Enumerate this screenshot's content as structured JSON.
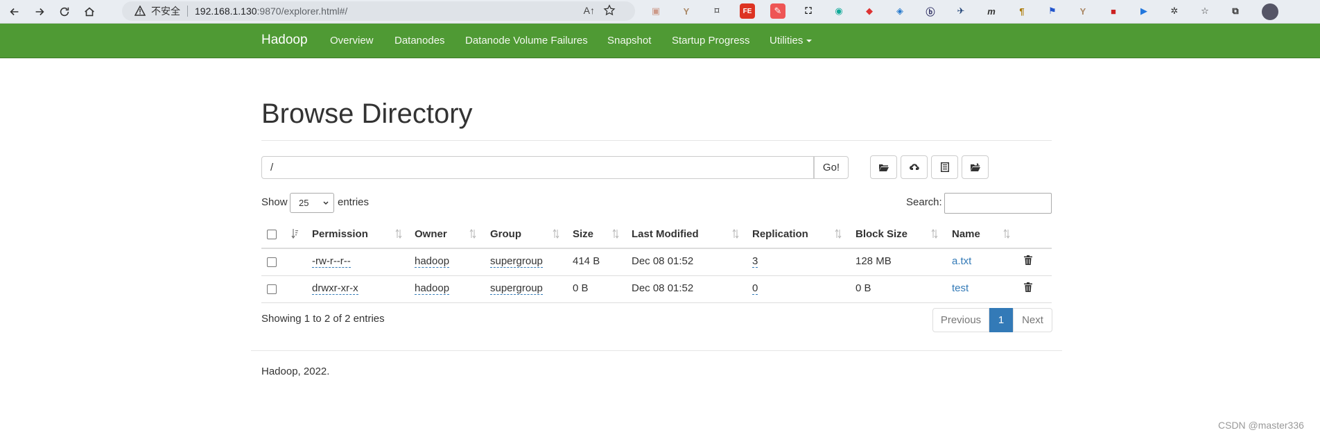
{
  "browser": {
    "insecure_label": "不安全",
    "url_host": "192.168.1.130",
    "url_rest": ":9870/explorer.html#/",
    "read_aloud": "A↑"
  },
  "navbar": {
    "brand": "Hadoop",
    "links": [
      "Overview",
      "Datanodes",
      "Datanode Volume Failures",
      "Snapshot",
      "Startup Progress",
      "Utilities"
    ]
  },
  "page": {
    "title": "Browse Directory",
    "path_value": "/",
    "go_label": "Go!",
    "show_label": "Show",
    "entries_select": "25",
    "entries_label": "entries",
    "search_label": "Search:"
  },
  "table": {
    "headers": [
      "Permission",
      "Owner",
      "Group",
      "Size",
      "Last Modified",
      "Replication",
      "Block Size",
      "Name"
    ],
    "rows": [
      {
        "permission": "-rw-r--r--",
        "owner": "hadoop",
        "group": "supergroup",
        "size": "414 B",
        "modified": "Dec 08 01:52",
        "replication": "3",
        "block_size": "128 MB",
        "name": "a.txt"
      },
      {
        "permission": "drwxr-xr-x",
        "owner": "hadoop",
        "group": "supergroup",
        "size": "0 B",
        "modified": "Dec 08 01:52",
        "replication": "0",
        "block_size": "0 B",
        "name": "test"
      }
    ]
  },
  "pagination": {
    "info": "Showing 1 to 2 of 2 entries",
    "previous": "Previous",
    "current": "1",
    "next": "Next"
  },
  "footer": {
    "text": "Hadoop, 2022.",
    "watermark": "CSDN @master336"
  },
  "colors": {
    "navbar": "#4f9a34",
    "link": "#337ab7",
    "active_page": "#337ab7"
  }
}
